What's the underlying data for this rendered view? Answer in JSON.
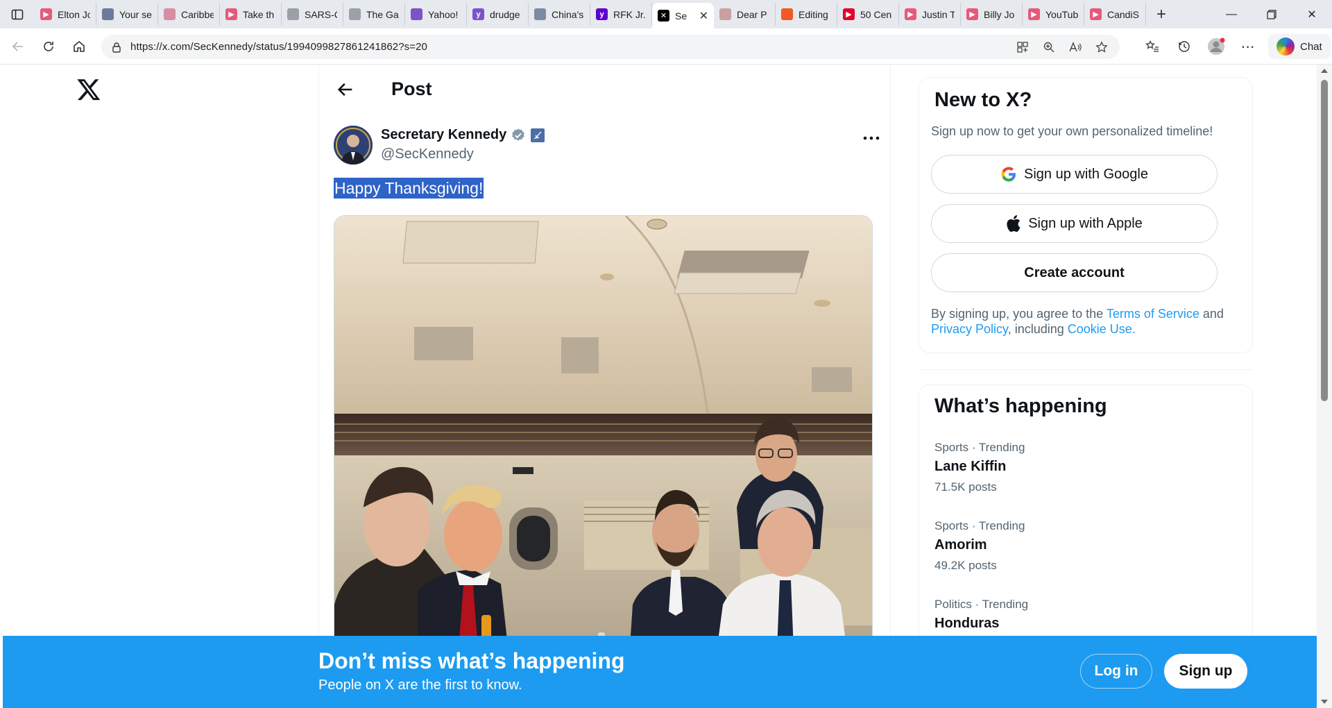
{
  "browser": {
    "tabs": [
      {
        "title": "Elton Jo",
        "fav_color": "#e8587a",
        "fav_icon": "youtube-icon"
      },
      {
        "title": "Your se",
        "fav_color": "#6b7a99",
        "fav_icon": "page-icon"
      },
      {
        "title": "Caribbe",
        "fav_color": "#d88ea0",
        "fav_icon": "page-icon"
      },
      {
        "title": "Take th",
        "fav_color": "#e8587a",
        "fav_icon": "youtube-icon"
      },
      {
        "title": "SARS-C",
        "fav_color": "#9aa0a6",
        "fav_icon": "page-icon"
      },
      {
        "title": "The Ga",
        "fav_color": "#9aa0a6",
        "fav_icon": "page-icon"
      },
      {
        "title": "Yahoo!",
        "fav_color": "#7b54c9",
        "fav_icon": "page-icon"
      },
      {
        "title": "drudge",
        "fav_color": "#7b54c9",
        "fav_icon": "yahoo-icon"
      },
      {
        "title": "China's",
        "fav_color": "#7d8aa3",
        "fav_icon": "page-icon"
      },
      {
        "title": "RFK Jr.",
        "fav_color": "#5f01d1",
        "fav_icon": "yahoo-icon"
      },
      {
        "title": "Se",
        "fav_color": "#000000",
        "fav_icon": "x-icon",
        "active": true
      },
      {
        "title": "Dear P",
        "fav_color": "#c9a0a0",
        "fav_icon": "page-icon"
      },
      {
        "title": "Editing",
        "fav_color": "#ef5a28",
        "fav_icon": "substack-icon"
      },
      {
        "title": "50 Cen",
        "fav_color": "#e5002b",
        "fav_icon": "youtube-icon"
      },
      {
        "title": "Justin T",
        "fav_color": "#e8587a",
        "fav_icon": "youtube-icon"
      },
      {
        "title": "Billy Jo",
        "fav_color": "#e8587a",
        "fav_icon": "youtube-icon"
      },
      {
        "title": "YouTub",
        "fav_color": "#e8587a",
        "fav_icon": "youtube-icon"
      },
      {
        "title": "CandiS",
        "fav_color": "#e8587a",
        "fav_icon": "youtube-icon"
      }
    ],
    "url": "https://x.com/SecKennedy/status/1994099827861241862?s=20",
    "chat_label": "Chat"
  },
  "post": {
    "header_title": "Post",
    "author_name": "Secretary Kennedy",
    "author_handle": "@SecKennedy",
    "text": "Happy Thanksgiving!"
  },
  "signup": {
    "title": "New to X?",
    "subtitle": "Sign up now to get your own personalized timeline!",
    "google_label": "Sign up with Google",
    "apple_label": "Sign up with Apple",
    "create_label": "Create account",
    "terms_prefix": "By signing up, you agree to the ",
    "terms_link": "Terms of Service",
    "terms_and": " and",
    "privacy_link": "Privacy Policy",
    "terms_including": ", including ",
    "cookie_link": "Cookie Use."
  },
  "happening": {
    "title": "What’s happening",
    "trends": [
      {
        "meta": "Sports · Trending",
        "topic": "Lane Kiffin",
        "count": "71.5K posts"
      },
      {
        "meta": "Sports · Trending",
        "topic": "Amorim",
        "count": "49.2K posts"
      },
      {
        "meta": "Politics · Trending",
        "topic": "Honduras",
        "count": ""
      }
    ]
  },
  "banner": {
    "headline": "Don’t miss what’s happening",
    "subline": "People on X are the first to know.",
    "login_label": "Log in",
    "signup_label": "Sign up"
  },
  "colors": {
    "accent": "#1d9bf0",
    "verified_badge": "#829aab",
    "gov_badge": "#4c6ea6"
  }
}
